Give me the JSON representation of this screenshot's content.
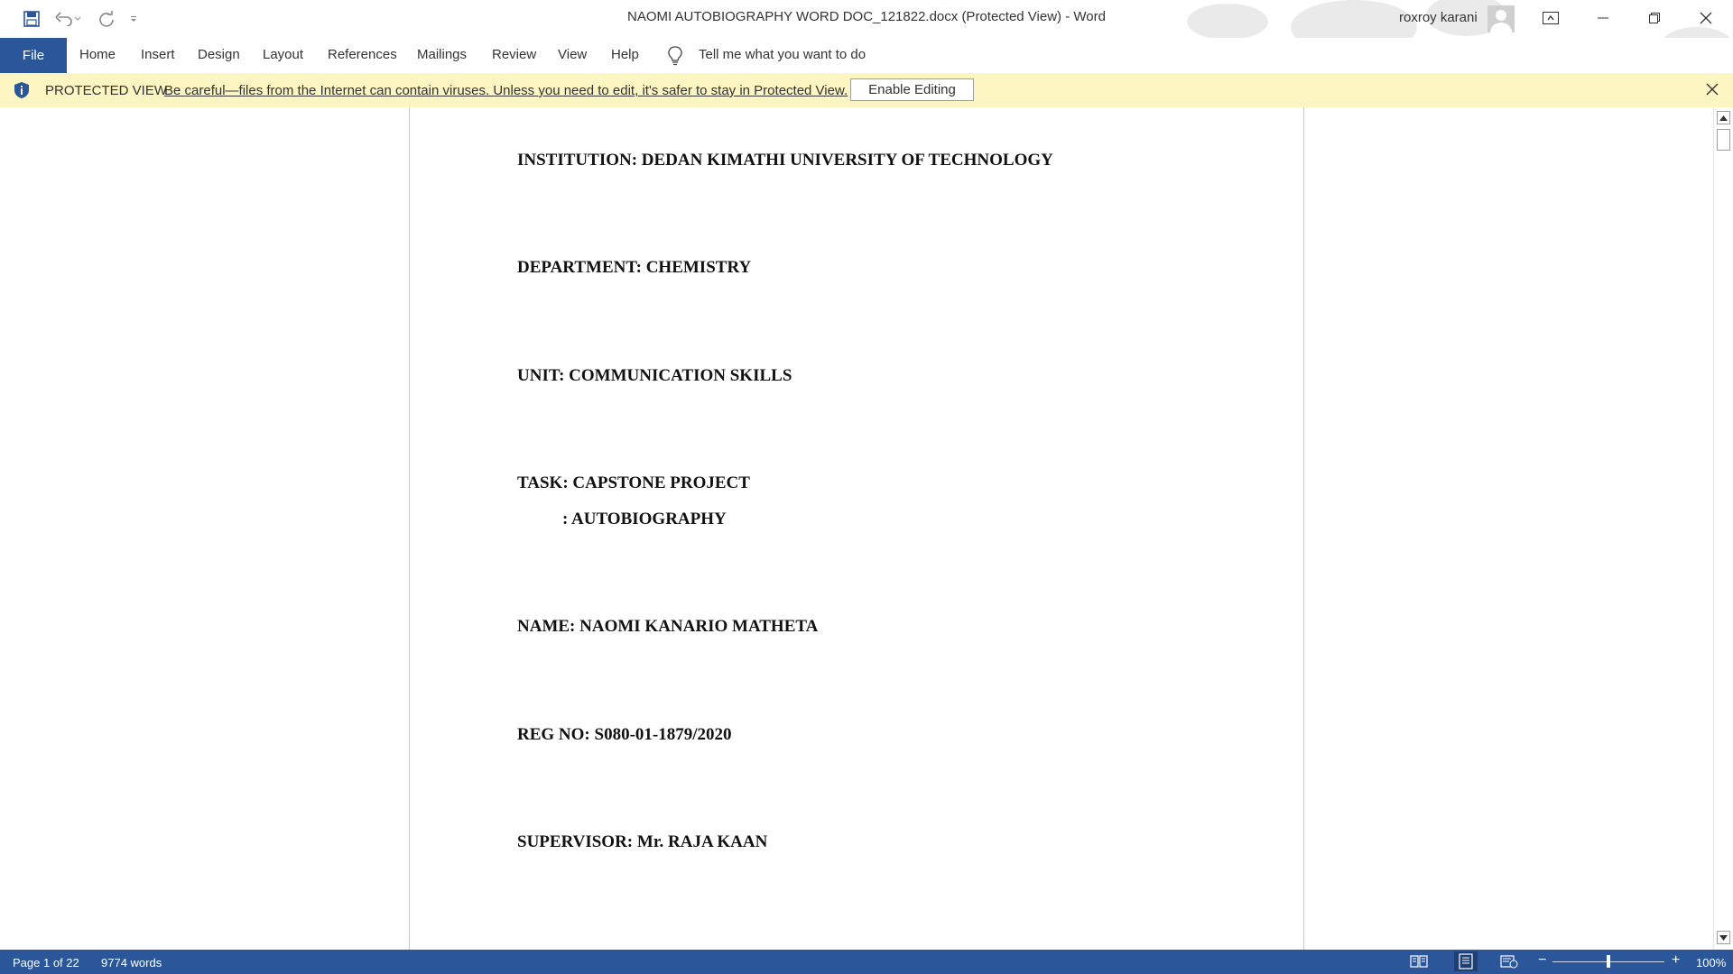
{
  "window": {
    "title": "NAOMI AUTOBIOGRAPHY WORD DOC_121822.docx (Protected View)  -  Word",
    "user_name": "roxroy karani"
  },
  "quick_access": {
    "icons": [
      "save-icon",
      "undo-icon",
      "redo-icon",
      "customize-qat-icon"
    ]
  },
  "ribbon": {
    "file_label": "File",
    "tabs": [
      "Home",
      "Insert",
      "Design",
      "Layout",
      "References",
      "Mailings",
      "Review",
      "View",
      "Help"
    ],
    "tell_me": "Tell me what you want to do"
  },
  "protected_view": {
    "label": "PROTECTED VIEW",
    "message": "Be careful—files from the Internet can contain viruses. Unless you need to edit, it's safer to stay in Protected View.",
    "button": "Enable Editing"
  },
  "document": {
    "lines": [
      "INSTITUTION: DEDAN KIMATHI UNIVERSITY OF TECHNOLOGY",
      "DEPARTMENT: CHEMISTRY",
      "UNIT: COMMUNICATION SKILLS",
      "TASK: CAPSTONE PROJECT",
      ": AUTOBIOGRAPHY",
      "NAME: NAOMI KANARIO MATHETA",
      "REG NO: S080-01-1879/2020",
      "SUPERVISOR: Mr. RAJA KAAN"
    ]
  },
  "status": {
    "page": "Page 1 of 22",
    "words": "9774 words",
    "zoom": "100%",
    "zoom_minus": "−",
    "zoom_plus": "+"
  },
  "colors": {
    "accent": "#2b579a",
    "protected_bar": "#fdf6c3"
  }
}
